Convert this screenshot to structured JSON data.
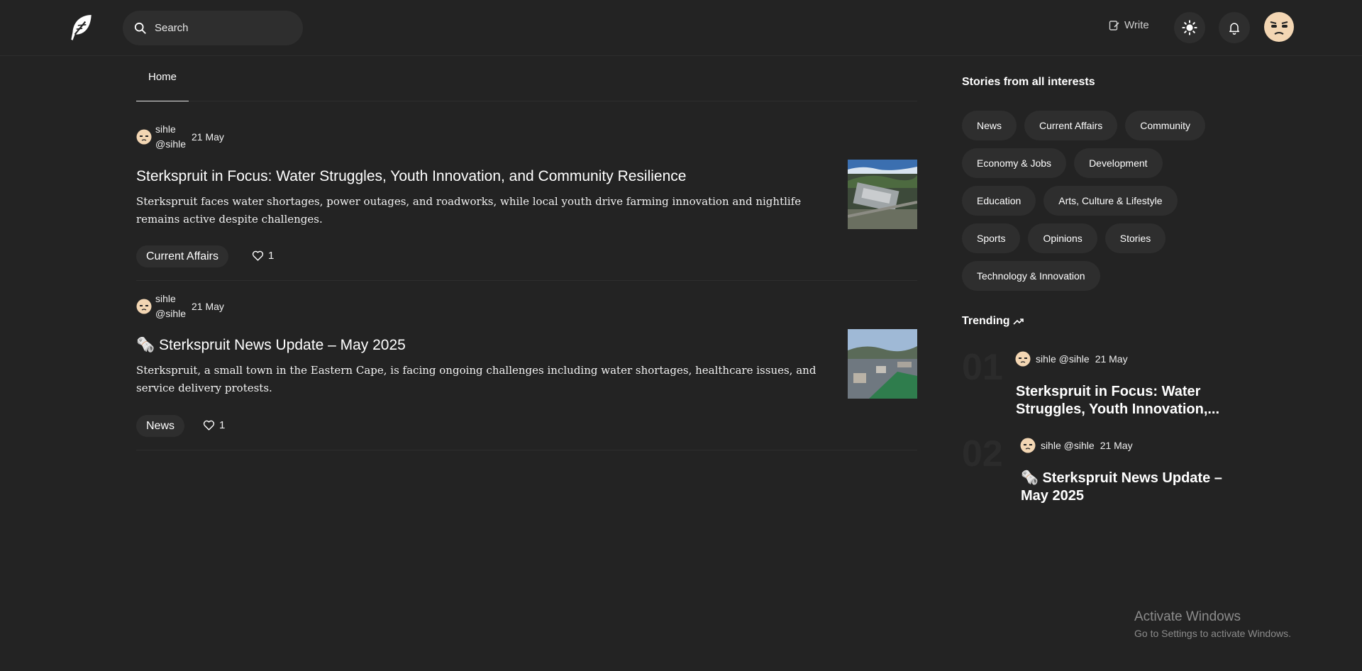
{
  "header": {
    "search_placeholder": "Search",
    "write_label": "Write"
  },
  "tabs": [
    {
      "label": "Home"
    }
  ],
  "posts": [
    {
      "author_name": "sihle",
      "author_handle": "@sihle",
      "date": "21 May",
      "title": "Sterkspruit in Focus: Water Struggles, Youth Innovation, and Community Resilience",
      "excerpt": "Sterkspruit faces water shortages, power outages, and roadworks, while local youth drive farming innovation and nightlife remains active despite challenges.",
      "category": "Current Affairs",
      "likes": "1"
    },
    {
      "author_name": "sihle",
      "author_handle": "@sihle",
      "date": "21 May",
      "title": "🗞️ Sterkspruit News Update – May 2025",
      "excerpt": "Sterkspruit, a small town in the Eastern Cape, is facing ongoing challenges including water shortages, healthcare issues, and service delivery protests.",
      "category": "News",
      "likes": "1"
    }
  ],
  "sidebar": {
    "interests_title": "Stories from all interests",
    "topics": [
      "News",
      "Current Affairs",
      "Community",
      "Economy & Jobs",
      "Development",
      "Education",
      "Arts, Culture & Lifestyle",
      "Sports",
      "Opinions",
      "Stories",
      "Technology & Innovation"
    ],
    "trending_title": "Trending",
    "trending": [
      {
        "rank": "01",
        "author": "sihle @sihle",
        "date": "21 May",
        "title": "Sterkspruit in Focus: Water Struggles, Youth Innovation,..."
      },
      {
        "rank": "02",
        "author": "sihle @sihle",
        "date": "21 May",
        "title": "🗞️ Sterkspruit News Update – May 2025"
      }
    ]
  },
  "watermark": {
    "line1": "Activate Windows",
    "line2": "Go to Settings to activate Windows."
  },
  "colors": {
    "background": "#232323",
    "surface": "#2e2e2e",
    "text": "#ffffff"
  }
}
